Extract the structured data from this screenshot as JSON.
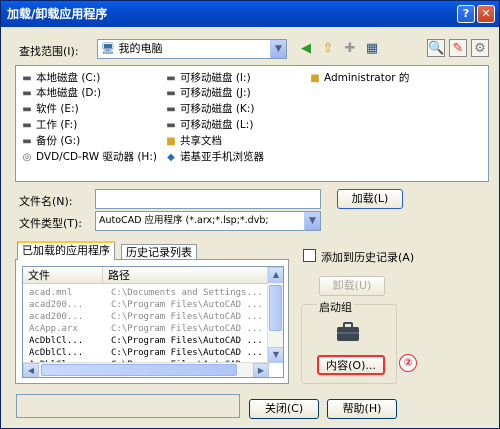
{
  "window": {
    "title": "加载/卸载应用程序",
    "help_btn": "?",
    "close_btn": "✕"
  },
  "lookin": {
    "label": "查找范围(I):",
    "value": "我的电脑"
  },
  "toolbar": {
    "back_icon": "back-icon",
    "up_icon": "up-folder-icon",
    "newfolder_icon": "new-folder-icon",
    "views_icon": "views-menu-icon"
  },
  "files": [
    {
      "name": "本地磁盘 (C:)",
      "icon": "drive"
    },
    {
      "name": "本地磁盘 (D:)",
      "icon": "drive"
    },
    {
      "name": "软件 (E:)",
      "icon": "drive"
    },
    {
      "name": "工作 (F:)",
      "icon": "drive"
    },
    {
      "name": "备份 (G:)",
      "icon": "drive"
    },
    {
      "name": "DVD/CD-RW 驱动器 (H:)",
      "icon": "cdrom"
    },
    {
      "name": "可移动磁盘 (I:)",
      "icon": "drive"
    },
    {
      "name": "可移动磁盘 (J:)",
      "icon": "drive"
    },
    {
      "name": "可移动磁盘 (K:)",
      "icon": "drive"
    },
    {
      "name": "可移动磁盘 (L:)",
      "icon": "drive"
    },
    {
      "name": "共享文档",
      "icon": "folder"
    },
    {
      "name": "诺基亚手机浏览器",
      "icon": "app"
    },
    {
      "name": "Administrator 的",
      "icon": "folder"
    }
  ],
  "filename": {
    "label": "文件名(N):",
    "value": ""
  },
  "filetype": {
    "label": "文件类型(T):",
    "value": "AutoCAD 应用程序 (*.arx;*.lsp;*.dvb;"
  },
  "buttons": {
    "load": "加载(L)",
    "unload": "卸载(U)",
    "contents": "内容(O)...",
    "close": "关闭(C)",
    "help": "帮助(H)"
  },
  "tabs": [
    {
      "label": "已加载的应用程序"
    },
    {
      "label": "历史记录列表"
    }
  ],
  "table": {
    "columns": [
      "文件",
      "路径"
    ],
    "rows": [
      {
        "file": "acad.mnl",
        "path": "C:\\Documents and Settings...",
        "dim": true
      },
      {
        "file": "acad200...",
        "path": "C:\\Program Files\\AutoCAD ...",
        "dim": true
      },
      {
        "file": "acad200...",
        "path": "C:\\Program Files\\AutoCAD ...",
        "dim": true
      },
      {
        "file": "AcApp.arx",
        "path": "C:\\Program Files\\AutoCAD ...",
        "dim": true
      },
      {
        "file": "AcDblCl...",
        "path": "C:\\Program Files\\AutoCAD ...",
        "dim": false
      },
      {
        "file": "AcDblCl...",
        "path": "C:\\Program Files\\AutoCAD ...",
        "dim": false
      },
      {
        "file": "AcDblCl...",
        "path": "C:\\Program Files\\AutoCAD ...",
        "dim": false
      }
    ]
  },
  "history_checkbox": {
    "label": "添加到历史记录(A)",
    "checked": false
  },
  "startup_group": {
    "label": "启动组",
    "icon": "briefcase-icon"
  },
  "callout": "②",
  "colors": {
    "titlebar": "#0548c8",
    "face": "#ece9d8",
    "callout": "#e03030",
    "highlight_border": "#ff2a2a"
  }
}
